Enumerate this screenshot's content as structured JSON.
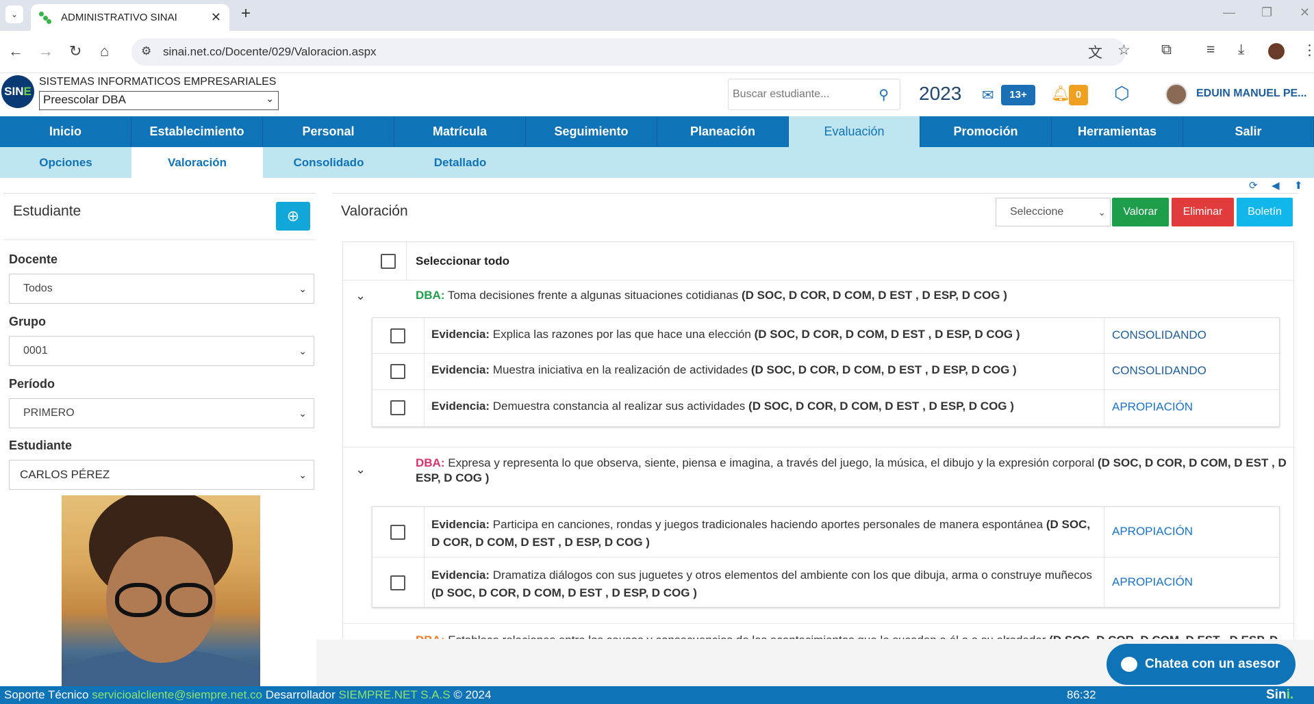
{
  "browser": {
    "tab_title": "ADMINISTRATIVO SINAI",
    "url": "sinai.net.co/Docente/029/Valoracion.aspx"
  },
  "header": {
    "company": "SISTEMAS INFORMATICOS EMPRESARIALES",
    "logo_text_a": "SIN",
    "logo_text_b": "E",
    "module": "Preescolar DBA",
    "search_placeholder": "Buscar estudiante...",
    "year": "2023",
    "mail_count": "13+",
    "notif_count": "0",
    "user_name": "EDUIN MANUEL PE..."
  },
  "main_nav": [
    "Inicio",
    "Establecimiento",
    "Personal",
    "Matrícula",
    "Seguimiento",
    "Planeación",
    "Evaluación",
    "Promoción",
    "Herramientas",
    "Salir"
  ],
  "sub_nav": [
    "Opciones",
    "Valoración",
    "Consolidado",
    "Detallado"
  ],
  "left": {
    "title": "Estudiante",
    "docente_label": "Docente",
    "docente_value": "Todos",
    "grupo_label": "Grupo",
    "grupo_value": "0001",
    "periodo_label": "Período",
    "periodo_value": "PRIMERO",
    "estudiante_label": "Estudiante",
    "estudiante_value": "CARLOS PÉREZ"
  },
  "right": {
    "title": "Valoración",
    "select_value": "Seleccione",
    "btn_valorar": "Valorar",
    "btn_eliminar": "Eliminar",
    "btn_boletin": "Boletín",
    "select_all": "Seleccionar todo",
    "dba_label": "DBA:",
    "ev_label": "Evidencia:",
    "dba1": {
      "text": "Toma decisiones frente a algunas situaciones cotidianas",
      "tags": "(D SOC, D COR, D COM, D EST , D ESP, D COG )"
    },
    "ev1": [
      {
        "text": "Explica las razones por las que hace una elección",
        "tags": "(D SOC, D COR, D COM, D EST , D ESP, D COG )",
        "value": "CONSOLIDANDO"
      },
      {
        "text": "Muestra iniciativa en la realización de actividades",
        "tags": "(D SOC, D COR, D COM, D EST , D ESP, D COG )",
        "value": "CONSOLIDANDO"
      },
      {
        "text": "Demuestra constancia al realizar sus actividades",
        "tags": "(D SOC, D COR, D COM, D EST , D ESP, D COG )",
        "value": "APROPIACIÓN"
      }
    ],
    "dba2": {
      "text": "Expresa y representa lo que observa, siente, piensa e imagina, a través del juego, la música, el dibujo y la expresión corporal",
      "tags": "(D SOC, D COR, D COM, D EST , D ESP, D COG )"
    },
    "ev2": [
      {
        "text": "Participa en canciones, rondas y juegos tradicionales haciendo aportes personales de manera espontánea",
        "tags": "(D SOC, D COR, D COM, D EST , D ESP, D COG )",
        "value": "APROPIACIÓN"
      },
      {
        "text": "Dramatiza diálogos con sus juguetes y otros elementos del ambiente con los que dibuja, arma o construye muñecos",
        "tags": "(D SOC, D COR, D COM, D EST , D ESP, D COG )",
        "value": "APROPIACIÓN"
      }
    ],
    "dba3": {
      "text": "Establece relaciones entre las causas y consecuencias de los acontecimientos que le suceden a él o a su alrededor",
      "tags": "(D SOC, D COR, D COM, D EST , D ESP, D"
    }
  },
  "chat": "Chatea con un asesor",
  "footer": {
    "support_label": "Soporte Técnico",
    "support_email": "servicioalcliente@siempre.net.co",
    "dev_label": "Desarrollador",
    "dev_name": "SIEMPRE.NET S.A.S",
    "copyright": "© 2024",
    "timer": "86:32",
    "brand_a": "Sin",
    "brand_b": "i."
  },
  "colors": {
    "primary": "#0f73b8",
    "subnav_bg": "#bee5f0",
    "valorar": "#1e9e4a",
    "eliminar": "#e23b3b",
    "boletin": "#11b7ea",
    "dba_green": "#1e9e4a",
    "dba_pink": "#d6336c",
    "dba_orange": "#f07b2b",
    "apropiacion": "#1a73c9"
  }
}
